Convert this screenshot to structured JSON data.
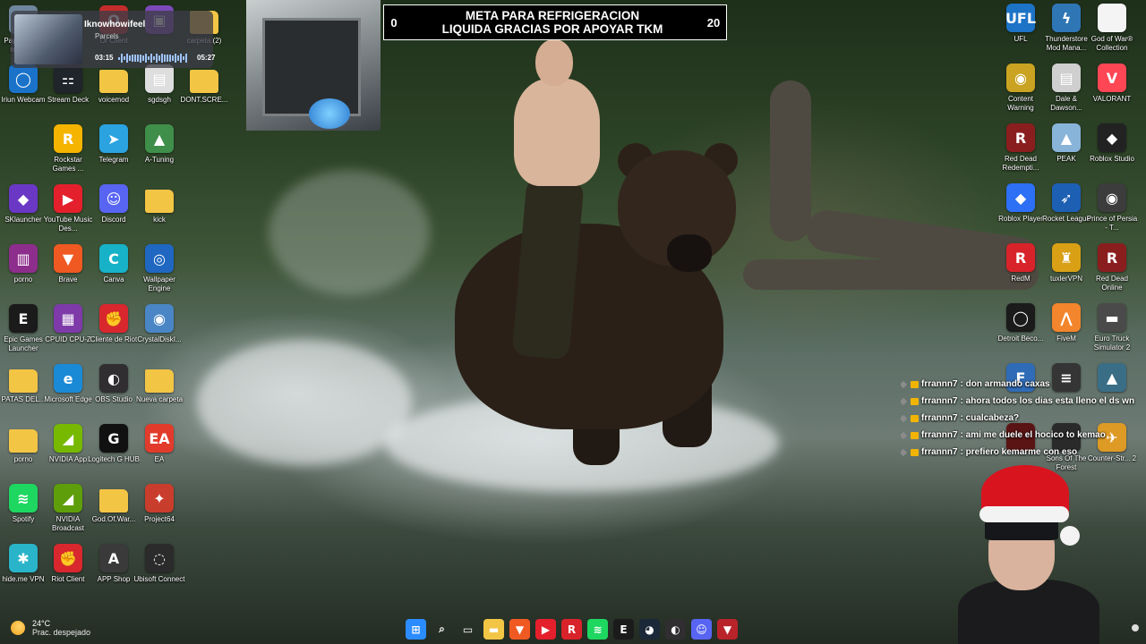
{
  "stream_goal": {
    "title_line1": "META PARA REFRIGERACION",
    "title_line2": "LIQUIDA GRACIAS POR APOYAR TKM",
    "current": "0",
    "target": "20",
    "progress": 0
  },
  "media_player": {
    "song": "Iknowhowifeel",
    "artist": "Parcels",
    "elapsed": "03:15",
    "duration": "05:27",
    "progress": 0.6
  },
  "desktop_icons_left": [
    {
      "label": "Papelera de reciclaje",
      "icon": "recycle-bin-icon",
      "color": "#6f879c",
      "glyph": "♻"
    },
    {
      "label": "Of Client",
      "icon": "client-icon",
      "color": "#c52c2c",
      "glyph": "O"
    },
    {
      "label": "",
      "icon": "app-icon",
      "color": "#7b4ab8",
      "glyph": "▣"
    },
    {
      "label": "carpeta (2)",
      "icon": "folder-icon",
      "color": "#f3c545",
      "glyph": ""
    },
    {
      "label": "Iriun Webcam",
      "icon": "iriun-webcam-icon",
      "color": "#1a73c9",
      "glyph": "◯"
    },
    {
      "label": "Stream Deck",
      "icon": "stream-deck-icon",
      "color": "#20242b",
      "glyph": "⚏"
    },
    {
      "label": "voicemod",
      "icon": "folder-icon",
      "color": "#f3c545",
      "glyph": ""
    },
    {
      "label": "sgdsgh",
      "icon": "image-icon",
      "color": "#dedede",
      "glyph": "▤"
    },
    {
      "label": "DONT.SCRE...",
      "icon": "folder-icon",
      "color": "#f3c545",
      "glyph": ""
    },
    {
      "label": "Rockstar Games ...",
      "icon": "rockstar-icon",
      "color": "#f5b400",
      "glyph": "R"
    },
    {
      "label": "Telegram",
      "icon": "telegram-icon",
      "color": "#2aa3e0",
      "glyph": "➤"
    },
    {
      "label": "A-Tuning",
      "icon": "a-tuning-icon",
      "color": "#3f8f4a",
      "glyph": "▲"
    },
    {
      "label": "SKlauncher",
      "icon": "sklauncher-icon",
      "color": "#6a38c4",
      "glyph": "◆"
    },
    {
      "label": "YouTube Music Des...",
      "icon": "youtube-music-icon",
      "color": "#e4202c",
      "glyph": "▶"
    },
    {
      "label": "Discord",
      "icon": "discord-icon",
      "color": "#5865f2",
      "glyph": "☺"
    },
    {
      "label": "kick",
      "icon": "folder-icon",
      "color": "#f3c545",
      "glyph": ""
    },
    {
      "label": "porno",
      "icon": "winrar-icon",
      "color": "#8d2d8c",
      "glyph": "▥"
    },
    {
      "label": "Brave",
      "icon": "brave-icon",
      "color": "#f05a22",
      "glyph": "▼"
    },
    {
      "label": "Canva",
      "icon": "canva-icon",
      "color": "#17b2c8",
      "glyph": "C"
    },
    {
      "label": "Wallpaper Engine",
      "icon": "wallpaper-engine-icon",
      "color": "#1f67c0",
      "glyph": "◎"
    },
    {
      "label": "Epic Games Launcher",
      "icon": "epic-games-icon",
      "color": "#1b1b1b",
      "glyph": "E"
    },
    {
      "label": "CPUID CPU-Z",
      "icon": "cpuz-icon",
      "color": "#7d3aa8",
      "glyph": "▦"
    },
    {
      "label": "Cliente de Riot",
      "icon": "riot-client-icon",
      "color": "#d9272e",
      "glyph": "✊"
    },
    {
      "label": "CrystalDiskI...",
      "icon": "crystaldisk-icon",
      "color": "#4a86c5",
      "glyph": "◉"
    },
    {
      "label": "PATAS DEL...",
      "icon": "folder-icon",
      "color": "#f3c545",
      "glyph": ""
    },
    {
      "label": "Microsoft Edge",
      "icon": "edge-icon",
      "color": "#1b8ad6",
      "glyph": "e"
    },
    {
      "label": "OBS Studio",
      "icon": "obs-icon",
      "color": "#302e31",
      "glyph": "◐"
    },
    {
      "label": "Nueva carpeta",
      "icon": "folder-icon",
      "color": "#f3c545",
      "glyph": ""
    },
    {
      "label": "porno",
      "icon": "folder-icon",
      "color": "#f3c545",
      "glyph": ""
    },
    {
      "label": "NVIDIA App",
      "icon": "nvidia-icon",
      "color": "#76b900",
      "glyph": "◢"
    },
    {
      "label": "Logitech G HUB",
      "icon": "logitech-icon",
      "color": "#111111",
      "glyph": "G"
    },
    {
      "label": "EA",
      "icon": "ea-icon",
      "color": "#e23b2b",
      "glyph": "EA"
    },
    {
      "label": "Spotify",
      "icon": "spotify-icon",
      "color": "#1ed760",
      "glyph": "≋"
    },
    {
      "label": "NVIDIA Broadcast",
      "icon": "nvidia-broadcast-icon",
      "color": "#5f9e0b",
      "glyph": "◢"
    },
    {
      "label": "God.Of.War...",
      "icon": "folder-icon",
      "color": "#f3c545",
      "glyph": ""
    },
    {
      "label": "Project64",
      "icon": "project64-icon",
      "color": "#c93d2d",
      "glyph": "✦"
    },
    {
      "label": "hide.me VPN",
      "icon": "hideme-icon",
      "color": "#29b4c9",
      "glyph": "✱"
    },
    {
      "label": "Riot Client",
      "icon": "riot-client-icon",
      "color": "#d9272e",
      "glyph": "✊"
    },
    {
      "label": "APP Shop",
      "icon": "app-shop-icon",
      "color": "#3a3a3a",
      "glyph": "A"
    },
    {
      "label": "Ubisoft Connect",
      "icon": "ubisoft-icon",
      "color": "#2b2b2b",
      "glyph": "◌"
    }
  ],
  "desktop_icons_right": [
    {
      "label": "UFL",
      "icon": "ufl-icon",
      "color": "#1d73c6",
      "glyph": "UFL"
    },
    {
      "label": "Thunderstore Mod Mana...",
      "icon": "thunderstore-icon",
      "color": "#2f76b5",
      "glyph": "ϟ"
    },
    {
      "label": "God of War® Collection",
      "icon": "file-icon",
      "color": "#f4f4f4",
      "glyph": ""
    },
    {
      "label": "Content Warning",
      "icon": "content-warning-icon",
      "color": "#c9a321",
      "glyph": "◉"
    },
    {
      "label": "Dale & Dawson...",
      "icon": "dale-dawson-icon",
      "color": "#cfcfcf",
      "glyph": "▤"
    },
    {
      "label": "VALORANT",
      "icon": "valorant-icon",
      "color": "#ff4655",
      "glyph": "V"
    },
    {
      "label": "Red Dead Redempti...",
      "icon": "red-dead-icon",
      "color": "#8a1e1e",
      "glyph": "R"
    },
    {
      "label": "PEAK",
      "icon": "peak-icon",
      "color": "#89b4d9",
      "glyph": "▲"
    },
    {
      "label": "Roblox Studio",
      "icon": "roblox-studio-icon",
      "color": "#222222",
      "glyph": "◆"
    },
    {
      "label": "Roblox Player",
      "icon": "roblox-icon",
      "color": "#2d6ff5",
      "glyph": "◆"
    },
    {
      "label": "Rocket League",
      "icon": "rocket-league-icon",
      "color": "#1d5fb3",
      "glyph": "➶"
    },
    {
      "label": "Prince of Persia - T...",
      "icon": "prince-of-persia-icon",
      "color": "#3c3c3c",
      "glyph": "◉"
    },
    {
      "label": "RedM",
      "icon": "redm-icon",
      "color": "#d8232a",
      "glyph": "R"
    },
    {
      "label": "tuxlerVPN",
      "icon": "tuxler-icon",
      "color": "#d9a016",
      "glyph": "♜"
    },
    {
      "label": "Red Dead Online",
      "icon": "red-dead-online-icon",
      "color": "#8a1e1e",
      "glyph": "R"
    },
    {
      "label": "Detroit Beco...",
      "icon": "detroit-icon",
      "color": "#1b1b1b",
      "glyph": "◯"
    },
    {
      "label": "FiveM",
      "icon": "fivem-icon",
      "color": "#f3852c",
      "glyph": "⋀"
    },
    {
      "label": "Euro Truck Simulator 2",
      "icon": "ets2-icon",
      "color": "#4a4a4a",
      "glyph": "▬"
    },
    {
      "label": "",
      "icon": "game-icon",
      "color": "#2f6bb6",
      "glyph": "F"
    },
    {
      "label": "",
      "icon": "game-icon",
      "color": "#353535",
      "glyph": "≡"
    },
    {
      "label": "",
      "icon": "warframe-icon",
      "color": "#3a6e86",
      "glyph": "▲"
    },
    {
      "label": "",
      "icon": "game-icon",
      "color": "#5a1414",
      "glyph": ""
    },
    {
      "label": "Sons Of The Forest",
      "icon": "sons-of-forest-icon",
      "color": "#2a2a2a",
      "glyph": ""
    },
    {
      "label": "Counter-Str... 2",
      "icon": "counter-strike-icon",
      "color": "#dd9a24",
      "glyph": "✈"
    }
  ],
  "chat": [
    {
      "user": "frrannn7",
      "message": ": don armando caxas"
    },
    {
      "user": "frrannn7",
      "message": ": ahora todos los dias esta lleno el ds wn"
    },
    {
      "user": "frrannn7",
      "message": ": cualcabeza?"
    },
    {
      "user": "frrannn7",
      "message": ": ami me duele el hocico to kemao"
    },
    {
      "user": "frrannn7",
      "message": ": prefiero kemarme con eso"
    }
  ],
  "taskbar": {
    "weather_temp": "24°C",
    "weather_condition": "Prac. despejado",
    "apps": [
      {
        "icon": "windows-start-icon",
        "color": "#2b8cff",
        "glyph": "⊞"
      },
      {
        "icon": "search-icon",
        "color": "transparent",
        "glyph": "⌕"
      },
      {
        "icon": "task-view-icon",
        "color": "transparent",
        "glyph": "▭"
      },
      {
        "icon": "file-explorer-icon",
        "color": "#f3c545",
        "glyph": "▬"
      },
      {
        "icon": "brave-icon",
        "color": "#f05a22",
        "glyph": "▼"
      },
      {
        "icon": "youtube-music-icon",
        "color": "#e4202c",
        "glyph": "▶"
      },
      {
        "icon": "redm-icon",
        "color": "#d8232a",
        "glyph": "R"
      },
      {
        "icon": "spotify-icon",
        "color": "#1ed760",
        "glyph": "≋"
      },
      {
        "icon": "epic-games-icon",
        "color": "#1b1b1b",
        "glyph": "E"
      },
      {
        "icon": "steam-icon",
        "color": "#1b2838",
        "glyph": "◕"
      },
      {
        "icon": "obs-icon",
        "color": "#302e31",
        "glyph": "◐"
      },
      {
        "icon": "discord-icon",
        "color": "#5865f2",
        "glyph": "☺"
      },
      {
        "icon": "app-icon",
        "color": "#b9232a",
        "glyph": "▼"
      }
    ]
  }
}
